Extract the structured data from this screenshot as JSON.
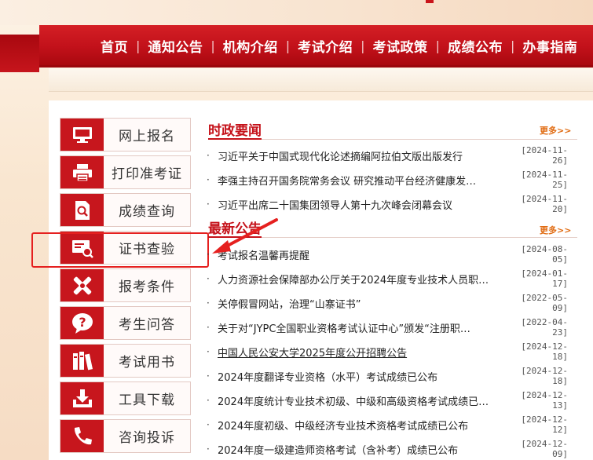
{
  "nav": {
    "items": [
      "首页",
      "通知公告",
      "机构介绍",
      "考试介绍",
      "考试政策",
      "成绩公布",
      "办事指南"
    ]
  },
  "sidebar": {
    "items": [
      {
        "label": "网上报名",
        "icon": "monitor-icon"
      },
      {
        "label": "打印准考证",
        "icon": "printer-icon"
      },
      {
        "label": "成绩查询",
        "icon": "document-search-icon"
      },
      {
        "label": "证书查验",
        "icon": "certificate-search-icon"
      },
      {
        "label": "报考条件",
        "icon": "tools-icon"
      },
      {
        "label": "考生问答",
        "icon": "question-icon"
      },
      {
        "label": "考试用书",
        "icon": "books-icon"
      },
      {
        "label": "工具下载",
        "icon": "download-icon"
      },
      {
        "label": "咨询投诉",
        "icon": "phone-icon"
      }
    ]
  },
  "politics": {
    "title": "时政要闻",
    "more": "更多>>",
    "items": [
      {
        "title": "习近平关于中国式现代化论述摘编阿拉伯文版出版发行",
        "date": "[2024-11-26]"
      },
      {
        "title": "李强主持召开国务院常务会议 研究推动平台经济健康发…",
        "date": "[2024-11-25]"
      },
      {
        "title": "习近平出席二十国集团领导人第十九次峰会闭幕会议",
        "date": "[2024-11-20]"
      }
    ]
  },
  "notices": {
    "title": "最新公告",
    "more": "更多>>",
    "items": [
      {
        "title": "考试报名温馨再提醒",
        "date": "[2024-08-05]"
      },
      {
        "title": "人力资源社会保障部办公厅关于2024年度专业技术人员职…",
        "date": "[2024-01-17]"
      },
      {
        "title": "关停假冒网站，治理“山寨证书”",
        "date": "[2022-05-09]"
      },
      {
        "title": "关于对“JYPC全国职业资格考试认证中心”颁发“注册职…",
        "date": "[2022-04-23]"
      },
      {
        "title": "中国人民公安大学2025年度公开招聘公告",
        "date": "[2024-12-18]"
      },
      {
        "title": "2024年度翻译专业资格（水平）考试成绩已公布",
        "date": "[2024-12-18]"
      },
      {
        "title": "2024年度统计专业技术初级、中级和高级资格考试成绩已…",
        "date": "[2024-12-13]"
      },
      {
        "title": "2024年度初级、中级经济专业技术资格考试成绩已公布",
        "date": "[2024-12-12]"
      },
      {
        "title": "2024年度一级建造师资格考试（含补考）成绩已公布",
        "date": "[2024-12-09]"
      }
    ]
  },
  "colors": {
    "brand_red": "#c7161d",
    "highlight": "#e5201f",
    "more_orange": "#e06a10"
  }
}
